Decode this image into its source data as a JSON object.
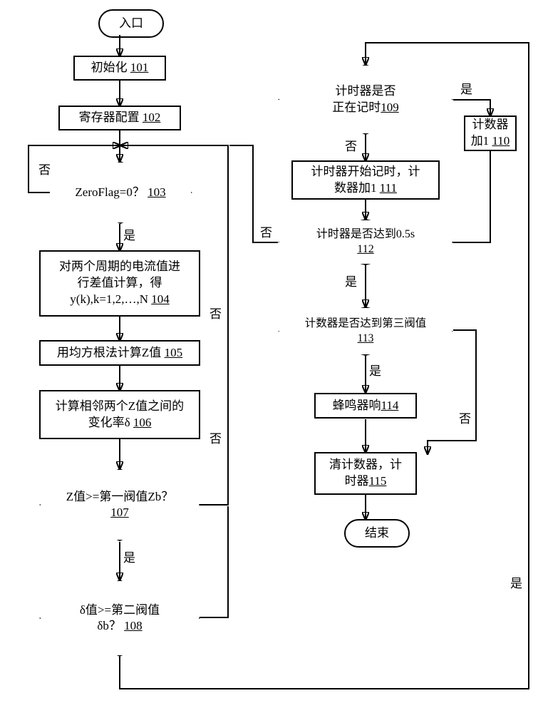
{
  "terminals": {
    "start": "入口",
    "end": "结束"
  },
  "nodes": {
    "n101": {
      "text": "初始化",
      "ref": "101"
    },
    "n102": {
      "text": "寄存器配置",
      "ref": "102"
    },
    "n103": {
      "text": "ZeroFlag=0？",
      "ref": "103"
    },
    "n104": {
      "line1": "对两个周期的电流值进",
      "line2": "行差值计算，得",
      "line3": "y(k),k=1,2,…,N",
      "ref": "104"
    },
    "n105": {
      "text": "用均方根法计算Z值",
      "ref": "105"
    },
    "n106": {
      "line1": "计算相邻两个Z值之间的",
      "line2": "变化率δ",
      "ref": "106"
    },
    "n107": {
      "line1": "Z值>=第一阀值Zb？",
      "ref": "107"
    },
    "n108": {
      "line1": "δ值>=第二阀值",
      "line2": "δb？",
      "ref": "108"
    },
    "n109": {
      "line1": "计时器是否",
      "line2": "正在记时",
      "ref": "109"
    },
    "n110": {
      "line1": "计数器",
      "line2": "加1",
      "ref": "110"
    },
    "n111": {
      "line1": "计时器开始记时，计",
      "line2": "数器加1",
      "ref": "111"
    },
    "n112": {
      "line1": "计时器是否达到0.5s",
      "ref": "112"
    },
    "n113": {
      "line1": "计数器是否达到第三阀值",
      "ref": "113"
    },
    "n114": {
      "text": "蜂鸣器响",
      "ref": "114"
    },
    "n115": {
      "line1": "清计数器，计",
      "line2": "时器",
      "ref": "115"
    }
  },
  "labels": {
    "yes": "是",
    "no": "否"
  }
}
